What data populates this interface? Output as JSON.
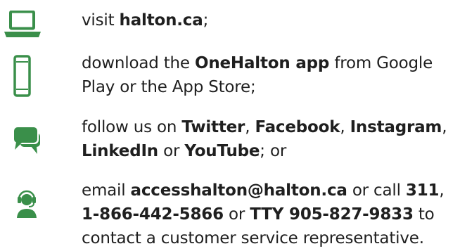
{
  "colors": {
    "accent": "#3a8f4a",
    "text": "#1f1f1f"
  },
  "items": [
    {
      "icon": "laptop-icon",
      "lines": [
        [
          {
            "t": "visit ",
            "b": false
          },
          {
            "t": "halton.ca",
            "b": true
          },
          {
            "t": ";",
            "b": false
          }
        ]
      ]
    },
    {
      "icon": "smartphone-icon",
      "lines": [
        [
          {
            "t": "download the ",
            "b": false
          },
          {
            "t": "OneHalton app",
            "b": true
          },
          {
            "t": " from Google",
            "b": false
          }
        ],
        [
          {
            "t": "Play or the App Store;",
            "b": false
          }
        ]
      ]
    },
    {
      "icon": "chat-bubbles-icon",
      "lines": [
        [
          {
            "t": "follow us on ",
            "b": false
          },
          {
            "t": "Twitter",
            "b": true
          },
          {
            "t": ", ",
            "b": false
          },
          {
            "t": "Facebook",
            "b": true
          },
          {
            "t": ", ",
            "b": false
          },
          {
            "t": "Instagram",
            "b": true
          },
          {
            "t": ",",
            "b": false
          }
        ],
        [
          {
            "t": "LinkedIn",
            "b": true
          },
          {
            "t": " or ",
            "b": false
          },
          {
            "t": "YouTube",
            "b": true
          },
          {
            "t": "; or",
            "b": false
          }
        ]
      ]
    },
    {
      "icon": "headset-agent-icon",
      "lines": [
        [
          {
            "t": "email ",
            "b": false
          },
          {
            "t": "accesshalton@halton.ca",
            "b": true
          },
          {
            "t": " or call ",
            "b": false
          },
          {
            "t": "311",
            "b": true
          },
          {
            "t": ",",
            "b": false
          }
        ],
        [
          {
            "t": "1-866-442-5866",
            "b": true
          },
          {
            "t": " or ",
            "b": false
          },
          {
            "t": "TTY 905-827-9833",
            "b": true
          },
          {
            "t": " to",
            "b": false
          }
        ],
        [
          {
            "t": "contact a customer service representative.",
            "b": false
          }
        ]
      ]
    }
  ]
}
